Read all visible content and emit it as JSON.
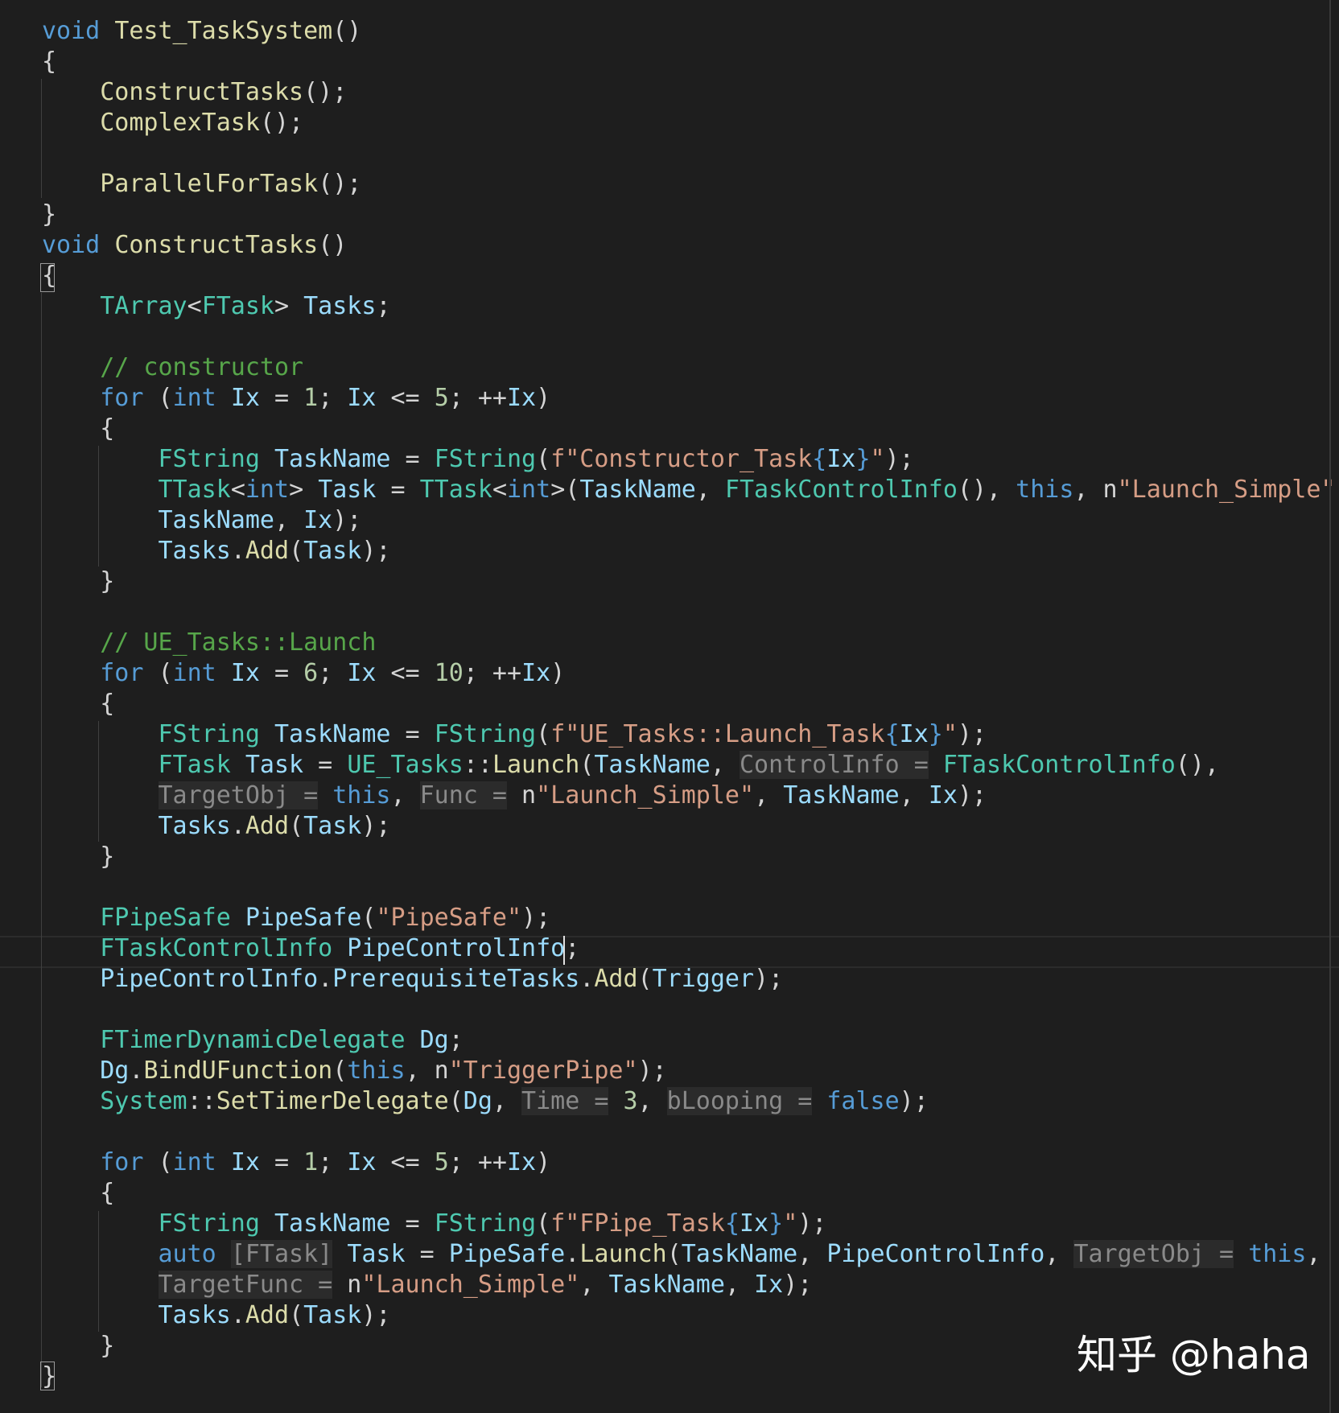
{
  "editor": {
    "lines": [
      [
        [
          "kw",
          "void"
        ],
        [
          "pl",
          " "
        ],
        [
          "fn",
          "Test_TaskSystem"
        ],
        [
          "pl",
          "()"
        ]
      ],
      [
        [
          "pl",
          "{"
        ]
      ],
      [
        [
          "pl",
          "    "
        ],
        [
          "fn",
          "ConstructTasks"
        ],
        [
          "pl",
          "();"
        ]
      ],
      [
        [
          "pl",
          "    "
        ],
        [
          "fn",
          "ComplexTask"
        ],
        [
          "pl",
          "();"
        ]
      ],
      [],
      [
        [
          "pl",
          "    "
        ],
        [
          "fn",
          "ParallelForTask"
        ],
        [
          "pl",
          "();"
        ]
      ],
      [
        [
          "pl",
          "}"
        ]
      ],
      [
        [
          "kw",
          "void"
        ],
        [
          "pl",
          " "
        ],
        [
          "fn",
          "ConstructTasks"
        ],
        [
          "pl",
          "()"
        ]
      ],
      [
        [
          "pl",
          "{"
        ]
      ],
      [
        [
          "pl",
          "    "
        ],
        [
          "ty",
          "TArray"
        ],
        [
          "pl",
          "<"
        ],
        [
          "ty",
          "FTask"
        ],
        [
          "pl",
          "> "
        ],
        [
          "var",
          "Tasks"
        ],
        [
          "pl",
          ";"
        ]
      ],
      [],
      [
        [
          "pl",
          "    "
        ],
        [
          "cm",
          "// constructor"
        ]
      ],
      [
        [
          "pl",
          "    "
        ],
        [
          "kw",
          "for"
        ],
        [
          "pl",
          " ("
        ],
        [
          "kw",
          "int"
        ],
        [
          "pl",
          " "
        ],
        [
          "var",
          "Ix"
        ],
        [
          "pl",
          " = "
        ],
        [
          "num",
          "1"
        ],
        [
          "pl",
          "; "
        ],
        [
          "var",
          "Ix"
        ],
        [
          "pl",
          " <= "
        ],
        [
          "num",
          "5"
        ],
        [
          "pl",
          "; ++"
        ],
        [
          "var",
          "Ix"
        ],
        [
          "pl",
          ")"
        ]
      ],
      [
        [
          "pl",
          "    {"
        ]
      ],
      [
        [
          "pl",
          "        "
        ],
        [
          "ty",
          "FString"
        ],
        [
          "pl",
          " "
        ],
        [
          "var",
          "TaskName"
        ],
        [
          "pl",
          " = "
        ],
        [
          "ty",
          "FString"
        ],
        [
          "pl",
          "("
        ],
        [
          "str",
          "f\"Constructor_Task"
        ],
        [
          "kw",
          "{"
        ],
        [
          "var",
          "Ix"
        ],
        [
          "kw",
          "}"
        ],
        [
          "str",
          "\""
        ],
        [
          "pl",
          ");"
        ]
      ],
      [
        [
          "pl",
          "        "
        ],
        [
          "ty",
          "TTask"
        ],
        [
          "pl",
          "<"
        ],
        [
          "kw",
          "int"
        ],
        [
          "pl",
          "> "
        ],
        [
          "var",
          "Task"
        ],
        [
          "pl",
          " = "
        ],
        [
          "ty",
          "TTask"
        ],
        [
          "pl",
          "<"
        ],
        [
          "kw",
          "int"
        ],
        [
          "pl",
          ">("
        ],
        [
          "var",
          "TaskName"
        ],
        [
          "pl",
          ", "
        ],
        [
          "ty",
          "FTaskControlInfo"
        ],
        [
          "pl",
          "(), "
        ],
        [
          "kw",
          "this"
        ],
        [
          "pl",
          ", "
        ],
        [
          "pl",
          "n"
        ],
        [
          "str",
          "\"Launch_Simple\""
        ],
        [
          "pl",
          ","
        ]
      ],
      [
        [
          "pl",
          "        "
        ],
        [
          "var",
          "TaskName"
        ],
        [
          "pl",
          ", "
        ],
        [
          "var",
          "Ix"
        ],
        [
          "pl",
          ");"
        ]
      ],
      [
        [
          "pl",
          "        "
        ],
        [
          "var",
          "Tasks"
        ],
        [
          "pl",
          "."
        ],
        [
          "fn",
          "Add"
        ],
        [
          "pl",
          "("
        ],
        [
          "var",
          "Task"
        ],
        [
          "pl",
          ");"
        ]
      ],
      [
        [
          "pl",
          "    }"
        ]
      ],
      [],
      [
        [
          "pl",
          "    "
        ],
        [
          "cm",
          "// UE_Tasks::Launch"
        ]
      ],
      [
        [
          "pl",
          "    "
        ],
        [
          "kw",
          "for"
        ],
        [
          "pl",
          " ("
        ],
        [
          "kw",
          "int"
        ],
        [
          "pl",
          " "
        ],
        [
          "var",
          "Ix"
        ],
        [
          "pl",
          " = "
        ],
        [
          "num",
          "6"
        ],
        [
          "pl",
          "; "
        ],
        [
          "var",
          "Ix"
        ],
        [
          "pl",
          " <= "
        ],
        [
          "num",
          "10"
        ],
        [
          "pl",
          "; ++"
        ],
        [
          "var",
          "Ix"
        ],
        [
          "pl",
          ")"
        ]
      ],
      [
        [
          "pl",
          "    {"
        ]
      ],
      [
        [
          "pl",
          "        "
        ],
        [
          "ty",
          "FString"
        ],
        [
          "pl",
          " "
        ],
        [
          "var",
          "TaskName"
        ],
        [
          "pl",
          " = "
        ],
        [
          "ty",
          "FString"
        ],
        [
          "pl",
          "("
        ],
        [
          "str",
          "f\"UE_Tasks::Launch_Task"
        ],
        [
          "kw",
          "{"
        ],
        [
          "var",
          "Ix"
        ],
        [
          "kw",
          "}"
        ],
        [
          "str",
          "\""
        ],
        [
          "pl",
          ");"
        ]
      ],
      [
        [
          "pl",
          "        "
        ],
        [
          "ty",
          "FTask"
        ],
        [
          "pl",
          " "
        ],
        [
          "var",
          "Task"
        ],
        [
          "pl",
          " = "
        ],
        [
          "ty",
          "UE_Tasks"
        ],
        [
          "pl",
          "::"
        ],
        [
          "fn",
          "Launch"
        ],
        [
          "pl",
          "("
        ],
        [
          "var",
          "TaskName"
        ],
        [
          "pl",
          ", "
        ],
        [
          "hint",
          "ControlInfo ="
        ],
        [
          "pl",
          " "
        ],
        [
          "ty",
          "FTaskControlInfo"
        ],
        [
          "pl",
          "(),"
        ]
      ],
      [
        [
          "pl",
          "        "
        ],
        [
          "hint",
          "TargetObj ="
        ],
        [
          "pl",
          " "
        ],
        [
          "kw",
          "this"
        ],
        [
          "pl",
          ", "
        ],
        [
          "hint",
          "Func ="
        ],
        [
          "pl",
          " n"
        ],
        [
          "str",
          "\"Launch_Simple\""
        ],
        [
          "pl",
          ", "
        ],
        [
          "var",
          "TaskName"
        ],
        [
          "pl",
          ", "
        ],
        [
          "var",
          "Ix"
        ],
        [
          "pl",
          ");"
        ]
      ],
      [
        [
          "pl",
          "        "
        ],
        [
          "var",
          "Tasks"
        ],
        [
          "pl",
          "."
        ],
        [
          "fn",
          "Add"
        ],
        [
          "pl",
          "("
        ],
        [
          "var",
          "Task"
        ],
        [
          "pl",
          ");"
        ]
      ],
      [
        [
          "pl",
          "    }"
        ]
      ],
      [],
      [
        [
          "pl",
          "    "
        ],
        [
          "ty",
          "FPipeSafe"
        ],
        [
          "pl",
          " "
        ],
        [
          "var",
          "PipeSafe"
        ],
        [
          "pl",
          "("
        ],
        [
          "str",
          "\"PipeSafe\""
        ],
        [
          "pl",
          ");"
        ]
      ],
      [
        [
          "pl",
          "    "
        ],
        [
          "ty",
          "FTaskControlInfo"
        ],
        [
          "pl",
          " "
        ],
        [
          "var",
          "PipeControlInfo"
        ],
        [
          "pl",
          ";"
        ]
      ],
      [
        [
          "pl",
          "    "
        ],
        [
          "var",
          "PipeControlInfo"
        ],
        [
          "pl",
          "."
        ],
        [
          "var",
          "PrerequisiteTasks"
        ],
        [
          "pl",
          "."
        ],
        [
          "fn",
          "Add"
        ],
        [
          "pl",
          "("
        ],
        [
          "var",
          "Trigger"
        ],
        [
          "pl",
          ");"
        ]
      ],
      [],
      [
        [
          "pl",
          "    "
        ],
        [
          "ty",
          "FTimerDynamicDelegate"
        ],
        [
          "pl",
          " "
        ],
        [
          "var",
          "Dg"
        ],
        [
          "pl",
          ";"
        ]
      ],
      [
        [
          "pl",
          "    "
        ],
        [
          "var",
          "Dg"
        ],
        [
          "pl",
          "."
        ],
        [
          "fn",
          "BindUFunction"
        ],
        [
          "pl",
          "("
        ],
        [
          "kw",
          "this"
        ],
        [
          "pl",
          ", n"
        ],
        [
          "str",
          "\"TriggerPipe\""
        ],
        [
          "pl",
          ");"
        ]
      ],
      [
        [
          "pl",
          "    "
        ],
        [
          "ty",
          "System"
        ],
        [
          "pl",
          "::"
        ],
        [
          "fn",
          "SetTimerDelegate"
        ],
        [
          "pl",
          "("
        ],
        [
          "var",
          "Dg"
        ],
        [
          "pl",
          ", "
        ],
        [
          "hint",
          "Time ="
        ],
        [
          "pl",
          " "
        ],
        [
          "num",
          "3"
        ],
        [
          "pl",
          ", "
        ],
        [
          "hint",
          "bLooping ="
        ],
        [
          "pl",
          " "
        ],
        [
          "kw",
          "false"
        ],
        [
          "pl",
          ");"
        ]
      ],
      [],
      [
        [
          "pl",
          "    "
        ],
        [
          "kw",
          "for"
        ],
        [
          "pl",
          " ("
        ],
        [
          "kw",
          "int"
        ],
        [
          "pl",
          " "
        ],
        [
          "var",
          "Ix"
        ],
        [
          "pl",
          " = "
        ],
        [
          "num",
          "1"
        ],
        [
          "pl",
          "; "
        ],
        [
          "var",
          "Ix"
        ],
        [
          "pl",
          " <= "
        ],
        [
          "num",
          "5"
        ],
        [
          "pl",
          "; ++"
        ],
        [
          "var",
          "Ix"
        ],
        [
          "pl",
          ")"
        ]
      ],
      [
        [
          "pl",
          "    {"
        ]
      ],
      [
        [
          "pl",
          "        "
        ],
        [
          "ty",
          "FString"
        ],
        [
          "pl",
          " "
        ],
        [
          "var",
          "TaskName"
        ],
        [
          "pl",
          " = "
        ],
        [
          "ty",
          "FString"
        ],
        [
          "pl",
          "("
        ],
        [
          "str",
          "f\"FPipe_Task"
        ],
        [
          "kw",
          "{"
        ],
        [
          "var",
          "Ix"
        ],
        [
          "kw",
          "}"
        ],
        [
          "str",
          "\""
        ],
        [
          "pl",
          ");"
        ]
      ],
      [
        [
          "pl",
          "        "
        ],
        [
          "kw",
          "auto"
        ],
        [
          "pl",
          " "
        ],
        [
          "hint",
          "[FTask]"
        ],
        [
          "pl",
          " "
        ],
        [
          "var",
          "Task"
        ],
        [
          "pl",
          " = "
        ],
        [
          "var",
          "PipeSafe"
        ],
        [
          "pl",
          "."
        ],
        [
          "fn",
          "Launch"
        ],
        [
          "pl",
          "("
        ],
        [
          "var",
          "TaskName"
        ],
        [
          "pl",
          ", "
        ],
        [
          "var",
          "PipeControlInfo"
        ],
        [
          "pl",
          ", "
        ],
        [
          "hint",
          "TargetObj ="
        ],
        [
          "pl",
          " "
        ],
        [
          "kw",
          "this"
        ],
        [
          "pl",
          ","
        ]
      ],
      [
        [
          "pl",
          "        "
        ],
        [
          "hint",
          "TargetFunc ="
        ],
        [
          "pl",
          " n"
        ],
        [
          "str",
          "\"Launch_Simple\""
        ],
        [
          "pl",
          ", "
        ],
        [
          "var",
          "TaskName"
        ],
        [
          "pl",
          ", "
        ],
        [
          "var",
          "Ix"
        ],
        [
          "pl",
          ");"
        ]
      ],
      [
        [
          "pl",
          "        "
        ],
        [
          "var",
          "Tasks"
        ],
        [
          "pl",
          "."
        ],
        [
          "fn",
          "Add"
        ],
        [
          "pl",
          "("
        ],
        [
          "var",
          "Task"
        ],
        [
          "pl",
          ");"
        ]
      ],
      [
        [
          "pl",
          "    }"
        ]
      ],
      [
        [
          "pl",
          "}"
        ]
      ]
    ]
  },
  "watermark": "知乎 @haha"
}
